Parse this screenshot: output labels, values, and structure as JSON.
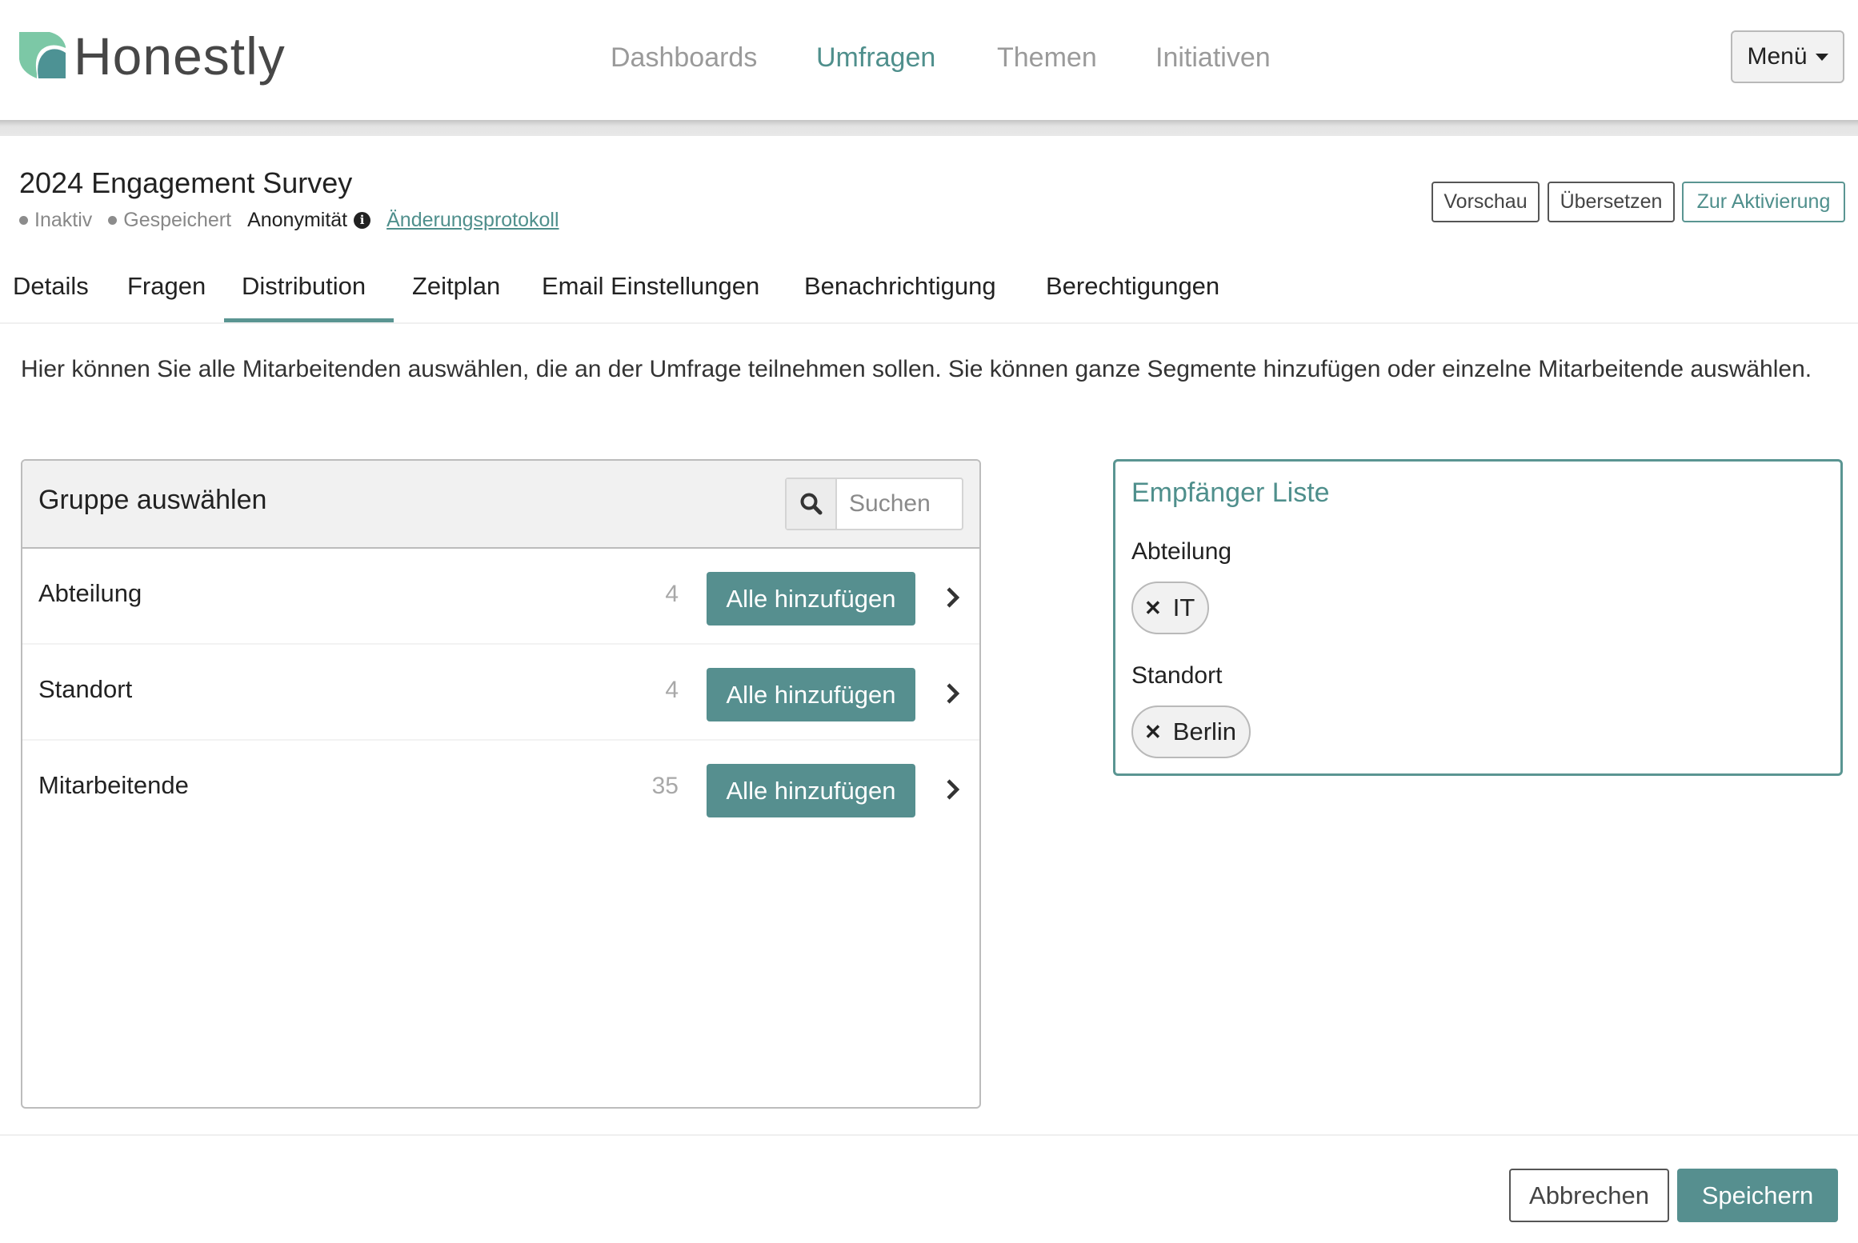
{
  "header": {
    "logo_text": "Honestly",
    "nav": [
      {
        "label": "Dashboards",
        "active": false
      },
      {
        "label": "Umfragen",
        "active": true
      },
      {
        "label": "Themen",
        "active": false
      },
      {
        "label": "Initiativen",
        "active": false
      }
    ],
    "menu_label": "Menü"
  },
  "survey": {
    "title": "2024 Engagement Survey",
    "status": "Inaktiv",
    "save_state": "Gespeichert",
    "anonymity_label": "Anonymität",
    "changelog_link": "Änderungsprotokoll",
    "actions": {
      "preview": "Vorschau",
      "translate": "Übersetzen",
      "activate": "Zur Aktivierung"
    }
  },
  "tabs": [
    {
      "label": "Details",
      "active": false
    },
    {
      "label": "Fragen",
      "active": false
    },
    {
      "label": "Distribution",
      "active": true
    },
    {
      "label": "Zeitplan",
      "active": false
    },
    {
      "label": "Email Einstellungen",
      "active": false
    },
    {
      "label": "Benachrichtigung",
      "active": false
    },
    {
      "label": "Berechtigungen",
      "active": false
    }
  ],
  "description": "Hier können Sie alle Mitarbeitenden auswählen, die an der Umfrage teilnehmen sollen. Sie können ganze Segmente hinzufügen oder einzelne Mitarbeitende auswählen.",
  "group_panel": {
    "title": "Gruppe auswählen",
    "search_placeholder": "Suchen",
    "search_value": "",
    "rows": [
      {
        "label": "Abteilung",
        "count": "4",
        "button": "Alle hinzufügen"
      },
      {
        "label": "Standort",
        "count": "4",
        "button": "Alle hinzufügen"
      },
      {
        "label": "Mitarbeitende",
        "count": "35",
        "button": "Alle hinzufügen"
      }
    ]
  },
  "recipients": {
    "title": "Empfänger Liste",
    "groups": [
      {
        "label": "Abteilung",
        "chips": [
          "IT"
        ]
      },
      {
        "label": "Standort",
        "chips": [
          "Berlin"
        ]
      }
    ]
  },
  "footer": {
    "cancel": "Abbrechen",
    "save": "Speichern"
  },
  "colors": {
    "accent": "#568f8f",
    "accent_text": "#4f8f8c",
    "logo_light": "#7cc8a6",
    "logo_dark": "#4d9294"
  }
}
